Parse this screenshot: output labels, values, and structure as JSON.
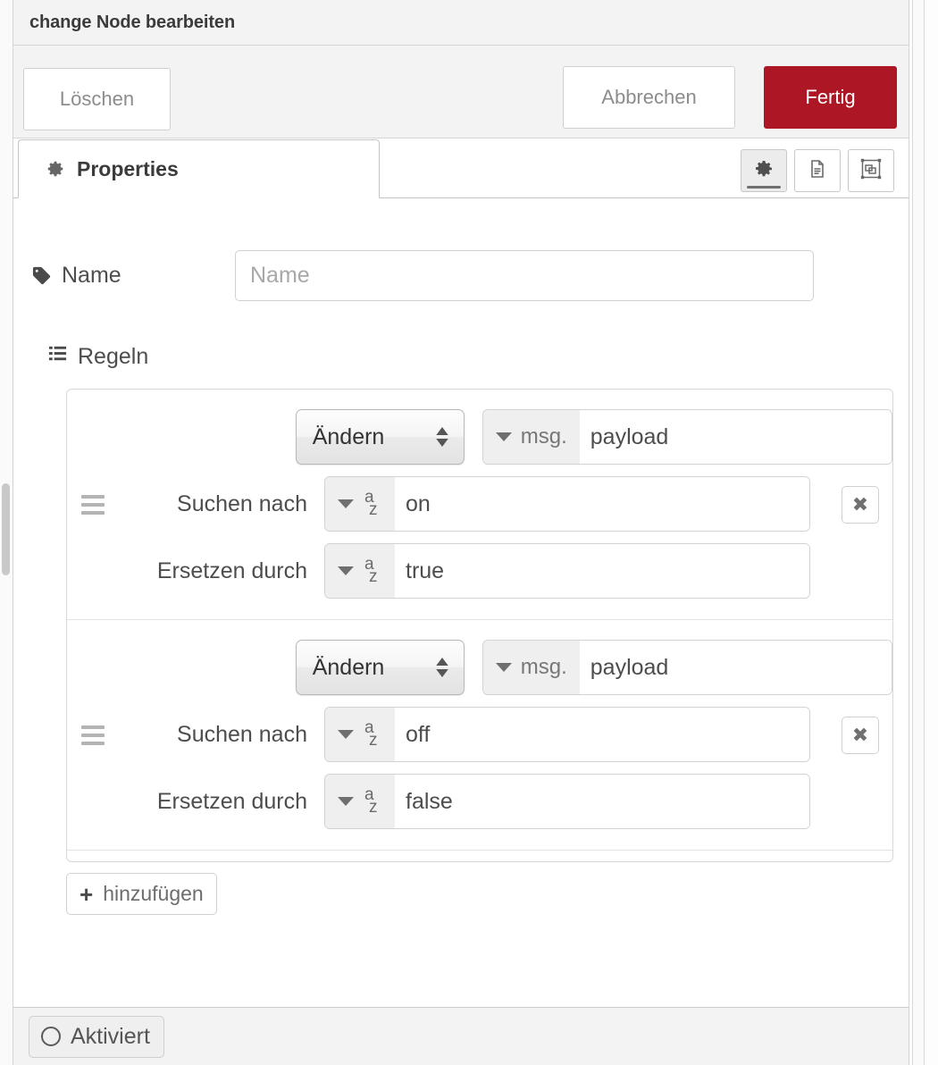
{
  "header": {
    "title": "change Node bearbeiten"
  },
  "buttons": {
    "delete": "Löschen",
    "cancel": "Abbrechen",
    "done": "Fertig"
  },
  "tabbar": {
    "tab_label": "Properties",
    "tab_icon": "gear-icon",
    "actions": [
      {
        "name": "properties-gear-icon",
        "selected": true
      },
      {
        "name": "description-document-icon",
        "selected": false
      },
      {
        "name": "node-appearance-icon",
        "selected": false
      }
    ]
  },
  "form": {
    "name_label": "Name",
    "name_icon": "tag-icon",
    "name_value": "",
    "name_placeholder": "Name",
    "rules_label": "Regeln",
    "rules_icon": "list-icon"
  },
  "rules": [
    {
      "action": "Ändern",
      "property_prefix": "msg.",
      "property_value": "payload",
      "search_label": "Suchen nach",
      "search_type": "az-string-icon",
      "search_value": "on",
      "replace_label": "Ersetzen durch",
      "replace_type": "az-string-icon",
      "replace_value": "true",
      "delete_label": "✖"
    },
    {
      "action": "Ändern",
      "property_prefix": "msg.",
      "property_value": "payload",
      "search_label": "Suchen nach",
      "search_type": "az-string-icon",
      "search_value": "off",
      "replace_label": "Ersetzen durch",
      "replace_type": "az-string-icon",
      "replace_value": "false",
      "delete_label": "✖"
    }
  ],
  "add_button": {
    "label": "hinzufügen",
    "icon": "plus-icon"
  },
  "footer": {
    "enabled_label": "Aktiviert",
    "enabled_icon": "circle-icon"
  },
  "colors": {
    "primary": "#ad1625",
    "header_bg": "#f3f3f3",
    "text": "#4d4d4d",
    "border": "#d3d3d3"
  }
}
